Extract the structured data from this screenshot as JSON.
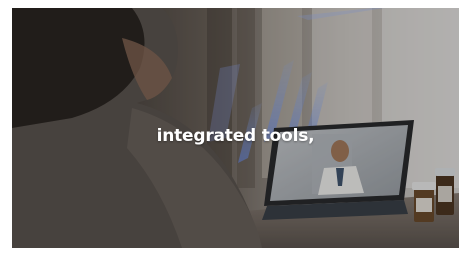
{
  "video": {
    "caption": "integrated tools,"
  }
}
